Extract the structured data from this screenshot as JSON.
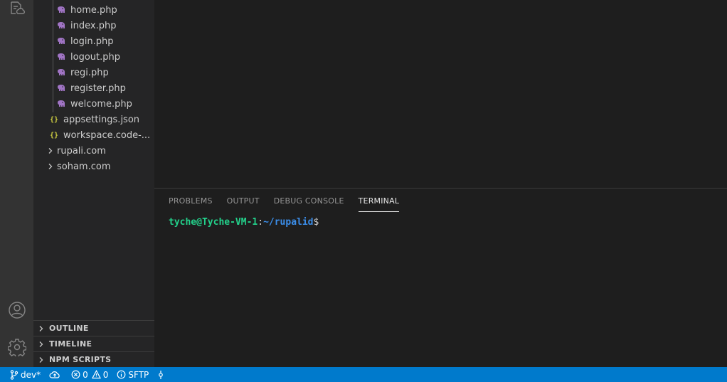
{
  "explorer": {
    "items": [
      {
        "label": "home.php",
        "type": "php"
      },
      {
        "label": "index.php",
        "type": "php"
      },
      {
        "label": "login.php",
        "type": "php"
      },
      {
        "label": "logout.php",
        "type": "php"
      },
      {
        "label": "regi.php",
        "type": "php"
      },
      {
        "label": "register.php",
        "type": "php"
      },
      {
        "label": "welcome.php",
        "type": "php"
      },
      {
        "label": "appsettings.json",
        "type": "json"
      },
      {
        "label": "workspace.code-...",
        "type": "json"
      },
      {
        "label": "rupali.com",
        "type": "folder"
      },
      {
        "label": "soham.com",
        "type": "folder"
      }
    ],
    "json_glyph": "{}"
  },
  "panels": {
    "outline": "OUTLINE",
    "timeline": "TIMELINE",
    "npm_scripts": "NPM SCRIPTS"
  },
  "bottom_panel": {
    "tabs": [
      "PROBLEMS",
      "OUTPUT",
      "DEBUG CONSOLE",
      "TERMINAL"
    ],
    "active_tab": "TERMINAL",
    "terminal": {
      "user": "tyche@Tyche-VM-1",
      "colon": ":",
      "path": "~/rupalid",
      "dollar": "$"
    }
  },
  "status_bar": {
    "branch": "dev*",
    "errors": "0",
    "warnings": "0",
    "sftp": "SFTP"
  },
  "icons": {
    "activity_top": "remote-explorer-icon",
    "account": "account-icon",
    "settings": "gear-icon"
  },
  "colors": {
    "status_bar": "#007acc",
    "activity_bar": "#333333",
    "sidebar": "#252526",
    "editor": "#1e1e1e",
    "terminal_user": "#23d18b",
    "terminal_path": "#3b8eea",
    "php_icon": "#a074c4",
    "json_icon": "#cbcb41"
  }
}
